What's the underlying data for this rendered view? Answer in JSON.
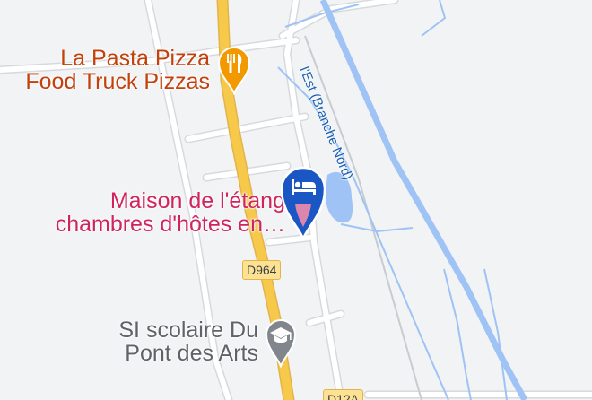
{
  "map": {
    "pois": {
      "food": {
        "line1": "La Pasta Pizza",
        "line2": "Food Truck Pizzas",
        "icon": "restaurant-icon"
      },
      "hotel": {
        "line1": "Maison de l'étang",
        "line2": "chambres d'hôtes en…",
        "icon": "bed-icon"
      },
      "school": {
        "line1": "SI scolaire Du",
        "line2": "Pont des Arts",
        "icon": "graduation-cap-icon"
      }
    },
    "roads": {
      "main": "D964",
      "secondary": "D12A"
    },
    "waterway": "l'Est (Branche Nord)",
    "colors": {
      "food_pin": "#f29900",
      "hotel_pin": "#1a56c4",
      "hotel_text": "#d0245d",
      "school_pin": "#80868b",
      "road_major": "#f6c94a",
      "water": "#9fc3f5"
    }
  }
}
